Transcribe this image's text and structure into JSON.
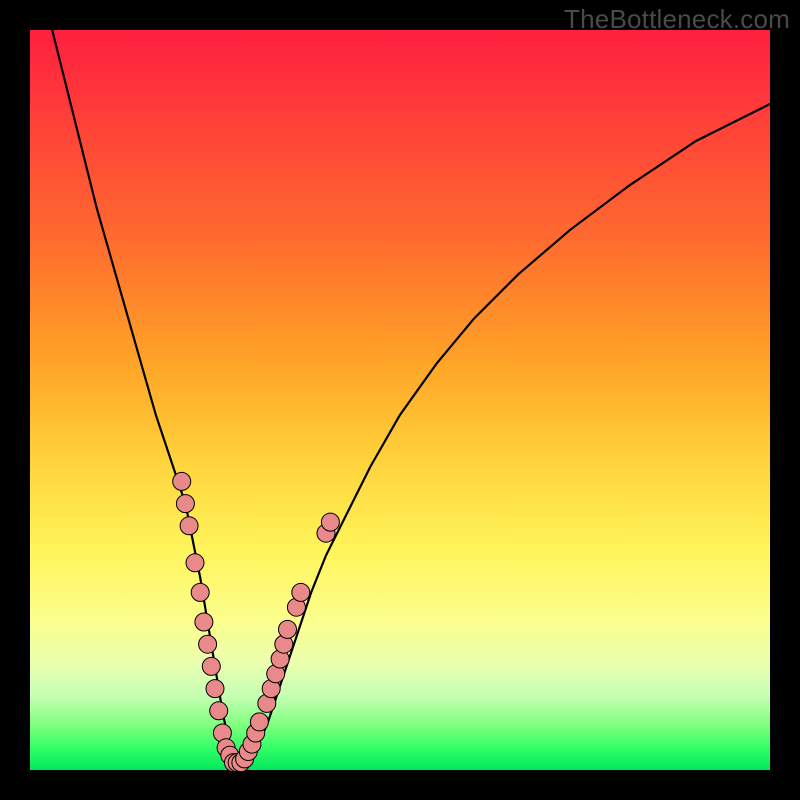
{
  "watermark": "TheBottleneck.com",
  "colors": {
    "curve_stroke": "#000000",
    "marker_fill": "#e98989",
    "marker_stroke": "#000000"
  },
  "chart_data": {
    "type": "line",
    "title": "",
    "xlabel": "",
    "ylabel": "",
    "xlim": [
      0,
      100
    ],
    "ylim": [
      0,
      100
    ],
    "series": [
      {
        "name": "bottleneck-curve",
        "x": [
          3,
          5,
          7,
          9,
          11,
          13,
          15,
          17,
          19,
          21,
          23,
          24,
          25,
          26,
          27,
          28,
          29,
          30,
          32,
          34,
          36,
          38,
          40,
          43,
          46,
          50,
          55,
          60,
          66,
          73,
          81,
          90,
          100
        ],
        "y": [
          100,
          92,
          84,
          76,
          69,
          62,
          55,
          48,
          42,
          36,
          26,
          20,
          14,
          8,
          3,
          1,
          1,
          2,
          6,
          12,
          18,
          24,
          29,
          35,
          41,
          48,
          55,
          61,
          67,
          73,
          79,
          85,
          90
        ]
      }
    ],
    "markers": [
      {
        "x": 20.5,
        "y": 39
      },
      {
        "x": 21.0,
        "y": 36
      },
      {
        "x": 21.5,
        "y": 33
      },
      {
        "x": 22.3,
        "y": 28
      },
      {
        "x": 23.0,
        "y": 24
      },
      {
        "x": 23.5,
        "y": 20
      },
      {
        "x": 24.0,
        "y": 17
      },
      {
        "x": 24.5,
        "y": 14
      },
      {
        "x": 25.0,
        "y": 11
      },
      {
        "x": 25.5,
        "y": 8
      },
      {
        "x": 26.0,
        "y": 5
      },
      {
        "x": 26.5,
        "y": 3
      },
      {
        "x": 27.0,
        "y": 2
      },
      {
        "x": 27.5,
        "y": 1
      },
      {
        "x": 28.0,
        "y": 1
      },
      {
        "x": 28.5,
        "y": 1
      },
      {
        "x": 29.0,
        "y": 1.5
      },
      {
        "x": 29.5,
        "y": 2.5
      },
      {
        "x": 30.0,
        "y": 3.5
      },
      {
        "x": 30.5,
        "y": 5
      },
      {
        "x": 31.0,
        "y": 6.5
      },
      {
        "x": 32.0,
        "y": 9
      },
      {
        "x": 32.6,
        "y": 11
      },
      {
        "x": 33.2,
        "y": 13
      },
      {
        "x": 33.8,
        "y": 15
      },
      {
        "x": 34.3,
        "y": 17
      },
      {
        "x": 34.8,
        "y": 19
      },
      {
        "x": 36.0,
        "y": 22
      },
      {
        "x": 36.6,
        "y": 24
      },
      {
        "x": 40.0,
        "y": 32
      },
      {
        "x": 40.6,
        "y": 33.5
      }
    ]
  }
}
